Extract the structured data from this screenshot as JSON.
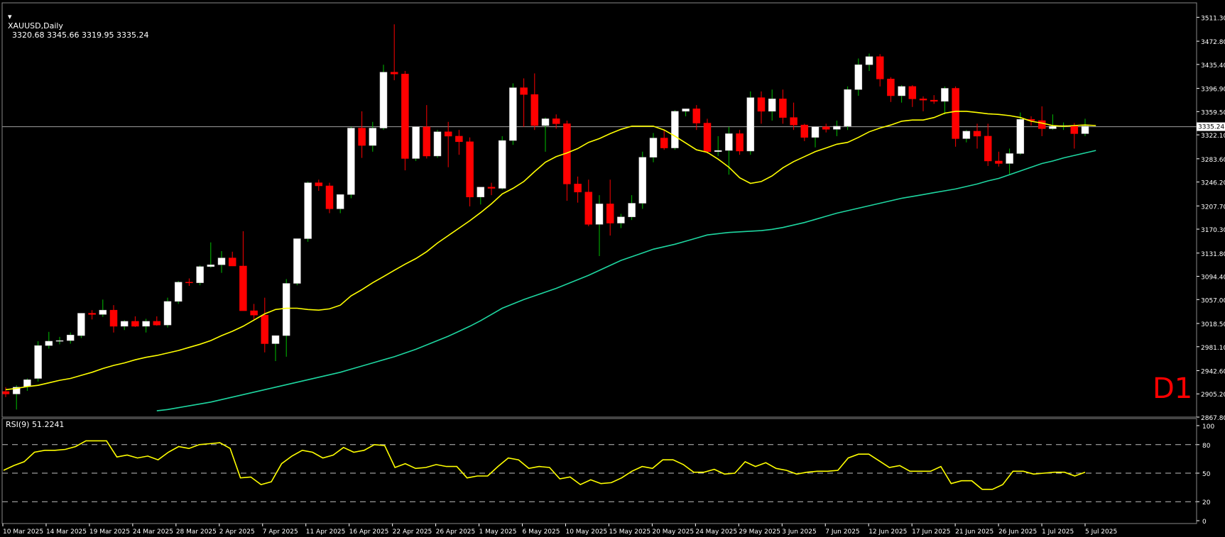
{
  "symbol": "XAUUSD,Daily",
  "ohlc_readout": "3320.68 3345.66 3319.95 3335.24",
  "timeframe_badge": "D1",
  "rsi_label": "RSI(9) 51.2241",
  "current_price_label": "3335.24",
  "colors": {
    "background": "#000000",
    "bull_body": "#ffffff",
    "bear_body": "#ff0000",
    "bull_wick": "#00c000",
    "bear_wick": "#ff0000",
    "fast_ma": "#ffff00",
    "slow_ma": "#1ed6a0",
    "rsi_line": "#ffff00",
    "grid_text": "#ffffff",
    "level_dash": "#c0c0c0"
  },
  "chart_data": [
    {
      "type": "candlestick",
      "title": "XAUUSD,Daily",
      "ylim": [
        2867.8,
        3530
      ],
      "y_ticks": [
        3511.3,
        3472.8,
        3435.4,
        3396.9,
        3359.5,
        3322.1,
        3283.6,
        3246.2,
        3207.7,
        3170.3,
        3131.8,
        3094.4,
        3057.0,
        3018.5,
        2981.1,
        2942.6,
        2905.2,
        2867.8
      ],
      "x_tick_labels": [
        "10 Mar 2025",
        "14 Mar 2025",
        "19 Mar 2025",
        "24 Mar 2025",
        "28 Mar 2025",
        "2 Apr 2025",
        "7 Apr 2025",
        "11 Apr 2025",
        "16 Apr 2025",
        "22 Apr 2025",
        "26 Apr 2025",
        "1 May 2025",
        "6 May 2025",
        "10 May 2025",
        "15 May 2025",
        "20 May 2025",
        "24 May 2025",
        "29 May 2025",
        "3 Jun 2025",
        "7 Jun 2025",
        "12 Jun 2025",
        "17 Jun 2025",
        "21 Jun 2025",
        "26 Jun 2025",
        "1 Jul 2025",
        "5 Jul 2025"
      ],
      "current_price": 3335.24,
      "candles": [
        [
          2909,
          2916,
          2900,
          2905
        ],
        [
          2905,
          2919,
          2880,
          2916
        ],
        [
          2917,
          2930,
          2910,
          2928
        ],
        [
          2930,
          2990,
          2925,
          2983
        ],
        [
          2983,
          3005,
          2978,
          2990
        ],
        [
          2990,
          2997,
          2985,
          2991
        ],
        [
          2991,
          3004,
          2986,
          3000
        ],
        [
          2999,
          3035,
          2995,
          3035
        ],
        [
          3035,
          3040,
          3025,
          3033
        ],
        [
          3033,
          3057,
          3029,
          3040
        ],
        [
          3040,
          3048,
          3004,
          3014
        ],
        [
          3014,
          3024,
          3008,
          3022
        ],
        [
          3022,
          3030,
          3013,
          3014
        ],
        [
          3014,
          3026,
          3004,
          3022
        ],
        [
          3022,
          3030,
          3015,
          3016
        ],
        [
          3016,
          3060,
          3012,
          3054
        ],
        [
          3054,
          3087,
          3050,
          3085
        ],
        [
          3085,
          3091,
          3079,
          3084
        ],
        [
          3084,
          3112,
          3080,
          3110
        ],
        [
          3110,
          3149,
          3108,
          3113
        ],
        [
          3113,
          3135,
          3100,
          3124
        ],
        [
          3124,
          3134,
          3111,
          3111
        ],
        [
          3111,
          3167,
          3050,
          3039
        ],
        [
          3039,
          3050,
          3025,
          3032
        ],
        [
          3032,
          3060,
          2972,
          2986
        ],
        [
          2986,
          2995,
          2958,
          2999
        ],
        [
          2999,
          3090,
          2965,
          3083
        ],
        [
          3083,
          3155,
          3080,
          3155
        ],
        [
          3155,
          3247,
          3150,
          3245
        ],
        [
          3245,
          3250,
          3232,
          3240
        ],
        [
          3240,
          3245,
          3196,
          3203
        ],
        [
          3203,
          3225,
          3196,
          3226
        ],
        [
          3226,
          3335,
          3220,
          3333
        ],
        [
          3333,
          3360,
          3285,
          3305
        ],
        [
          3305,
          3343,
          3295,
          3333
        ],
        [
          3333,
          3435,
          3330,
          3423
        ],
        [
          3423,
          3500,
          3410,
          3420
        ],
        [
          3420,
          3425,
          3265,
          3284
        ],
        [
          3284,
          3335,
          3280,
          3335
        ],
        [
          3335,
          3370,
          3284,
          3288
        ],
        [
          3288,
          3330,
          3285,
          3327
        ],
        [
          3327,
          3343,
          3270,
          3320
        ],
        [
          3320,
          3330,
          3290,
          3311
        ],
        [
          3311,
          3318,
          3207,
          3222
        ],
        [
          3222,
          3235,
          3210,
          3238
        ],
        [
          3238,
          3245,
          3225,
          3236
        ],
        [
          3236,
          3320,
          3234,
          3313
        ],
        [
          3313,
          3405,
          3306,
          3398
        ],
        [
          3398,
          3413,
          3335,
          3387
        ],
        [
          3387,
          3421,
          3330,
          3337
        ],
        [
          3337,
          3350,
          3295,
          3348
        ],
        [
          3348,
          3355,
          3332,
          3340
        ],
        [
          3340,
          3345,
          3216,
          3243
        ],
        [
          3243,
          3255,
          3213,
          3230
        ],
        [
          3230,
          3250,
          3175,
          3178
        ],
        [
          3178,
          3225,
          3127,
          3211
        ],
        [
          3211,
          3250,
          3160,
          3180
        ],
        [
          3180,
          3195,
          3172,
          3190
        ],
        [
          3190,
          3225,
          3185,
          3212
        ],
        [
          3212,
          3295,
          3203,
          3286
        ],
        [
          3286,
          3325,
          3278,
          3317
        ],
        [
          3317,
          3330,
          3298,
          3301
        ],
        [
          3301,
          3362,
          3298,
          3360
        ],
        [
          3360,
          3364,
          3352,
          3364
        ],
        [
          3364,
          3370,
          3330,
          3341
        ],
        [
          3341,
          3348,
          3292,
          3295
        ],
        [
          3295,
          3320,
          3288,
          3297
        ],
        [
          3297,
          3335,
          3258,
          3324
        ],
        [
          3324,
          3330,
          3290,
          3296
        ],
        [
          3296,
          3392,
          3290,
          3382
        ],
        [
          3382,
          3392,
          3340,
          3360
        ],
        [
          3360,
          3395,
          3345,
          3380
        ],
        [
          3380,
          3395,
          3340,
          3350
        ],
        [
          3350,
          3374,
          3330,
          3338
        ],
        [
          3338,
          3340,
          3312,
          3318
        ],
        [
          3318,
          3330,
          3302,
          3335
        ],
        [
          3335,
          3340,
          3326,
          3331
        ],
        [
          3331,
          3345,
          3320,
          3336
        ],
        [
          3336,
          3400,
          3330,
          3395
        ],
        [
          3395,
          3445,
          3385,
          3435
        ],
        [
          3435,
          3453,
          3425,
          3448
        ],
        [
          3448,
          3452,
          3400,
          3412
        ],
        [
          3412,
          3415,
          3375,
          3385
        ],
        [
          3385,
          3402,
          3374,
          3400
        ],
        [
          3400,
          3402,
          3367,
          3380
        ],
        [
          3380,
          3384,
          3360,
          3378
        ],
        [
          3378,
          3386,
          3372,
          3376
        ],
        [
          3376,
          3400,
          3355,
          3397
        ],
        [
          3397,
          3400,
          3303,
          3316
        ],
        [
          3316,
          3330,
          3310,
          3328
        ],
        [
          3328,
          3340,
          3300,
          3320
        ],
        [
          3320,
          3340,
          3272,
          3280
        ],
        [
          3280,
          3295,
          3271,
          3276
        ],
        [
          3276,
          3300,
          3259,
          3292
        ],
        [
          3292,
          3358,
          3290,
          3347
        ],
        [
          3347,
          3352,
          3337,
          3345
        ],
        [
          3345,
          3368,
          3320,
          3332
        ],
        [
          3332,
          3355,
          3330,
          3336
        ],
        [
          3336,
          3342,
          3330,
          3337
        ],
        [
          3337,
          3341,
          3300,
          3324
        ],
        [
          3324,
          3348,
          3320,
          3336
        ]
      ],
      "fast_ma": [
        2912,
        2914,
        2917,
        2919,
        2923,
        2927,
        2930,
        2935,
        2940,
        2946,
        2951,
        2955,
        2960,
        2964,
        2967,
        2971,
        2975,
        2980,
        2985,
        2991,
        2999,
        3006,
        3014,
        3024,
        3034,
        3041,
        3043,
        3043,
        3041,
        3040,
        3042,
        3048,
        3063,
        3073,
        3084,
        3094,
        3104,
        3114,
        3123,
        3134,
        3148,
        3160,
        3172,
        3184,
        3197,
        3211,
        3227,
        3236,
        3247,
        3263,
        3278,
        3287,
        3293,
        3300,
        3310,
        3316,
        3324,
        3331,
        3336,
        3336,
        3336,
        3330,
        3320,
        3309,
        3298,
        3294,
        3283,
        3270,
        3253,
        3244,
        3247,
        3256,
        3269,
        3279,
        3287,
        3295,
        3301,
        3307,
        3310,
        3318,
        3327,
        3333,
        3338,
        3344,
        3346,
        3346,
        3350,
        3357,
        3360,
        3360,
        3358,
        3356,
        3355,
        3353,
        3350,
        3344,
        3341,
        3337,
        3336,
        3337,
        3338,
        3337
      ],
      "slow_ma": [
        2850,
        2852,
        2854,
        2856,
        2858,
        2860,
        2862,
        2864,
        2866,
        2868,
        2870,
        2872,
        2874,
        2876,
        2878,
        2880,
        2883,
        2886,
        2889,
        2892,
        2896,
        2900,
        2904,
        2908,
        2912,
        2916,
        2920,
        2924,
        2928,
        2932,
        2936,
        2940,
        2945,
        2950,
        2955,
        2960,
        2965,
        2971,
        2977,
        2984,
        2991,
        2998,
        3006,
        3014,
        3023,
        3033,
        3043,
        3050,
        3057,
        3063,
        3069,
        3075,
        3082,
        3089,
        3096,
        3104,
        3112,
        3120,
        3126,
        3132,
        3138,
        3142,
        3146,
        3151,
        3156,
        3161,
        3163,
        3165,
        3166,
        3167,
        3168,
        3170,
        3173,
        3177,
        3181,
        3186,
        3191,
        3196,
        3200,
        3204,
        3208,
        3212,
        3216,
        3220,
        3223,
        3226,
        3229,
        3232,
        3235,
        3239,
        3243,
        3248,
        3252,
        3258,
        3264,
        3270,
        3276,
        3280,
        3285,
        3289,
        3293,
        3297
      ],
      "fast_ma_visible_from": 0,
      "slow_ma_visible_from": 14
    },
    {
      "type": "line",
      "title": "RSI(9) 51.2241",
      "ylim": [
        0,
        100
      ],
      "y_ticks": [
        100,
        80,
        50,
        20,
        0
      ],
      "levels": [
        80,
        50,
        20
      ],
      "values": [
        53,
        58,
        62,
        72,
        74,
        74,
        75,
        78,
        84,
        84,
        84,
        67,
        69,
        66,
        68,
        64,
        72,
        78,
        76,
        80,
        81,
        82,
        76,
        45,
        46,
        38,
        41,
        60,
        68,
        74,
        72,
        66,
        69,
        77,
        72,
        74,
        80,
        79,
        56,
        60,
        55,
        56,
        59,
        57,
        57,
        45,
        47,
        47,
        57,
        66,
        64,
        55,
        57,
        56,
        44,
        46,
        38,
        43,
        39,
        40,
        45,
        52,
        57,
        55,
        64,
        64,
        59,
        51,
        51,
        54,
        49,
        50,
        62,
        57,
        61,
        55,
        53,
        49,
        51,
        52,
        52,
        53,
        66,
        70,
        70,
        63,
        56,
        58,
        52,
        52,
        52,
        57,
        39,
        42,
        42,
        33,
        33,
        38,
        52,
        52,
        49,
        50,
        51,
        51,
        47,
        51
      ]
    }
  ]
}
